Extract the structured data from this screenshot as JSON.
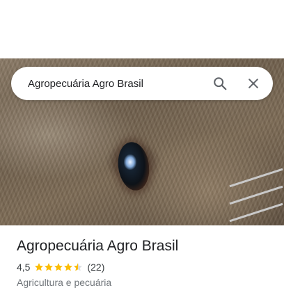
{
  "search": {
    "query": "Agropecuária Agro Brasil"
  },
  "place": {
    "name": "Agropecuária Agro Brasil",
    "rating": "4,5",
    "rating_stars": 4.5,
    "reviews": "(22)",
    "category": "Agricultura e pecuária"
  },
  "colors": {
    "star": "#fbbc04",
    "icon": "#5f6368",
    "title": "#202124"
  },
  "icons": {
    "search": "search-icon",
    "close": "close-icon"
  }
}
